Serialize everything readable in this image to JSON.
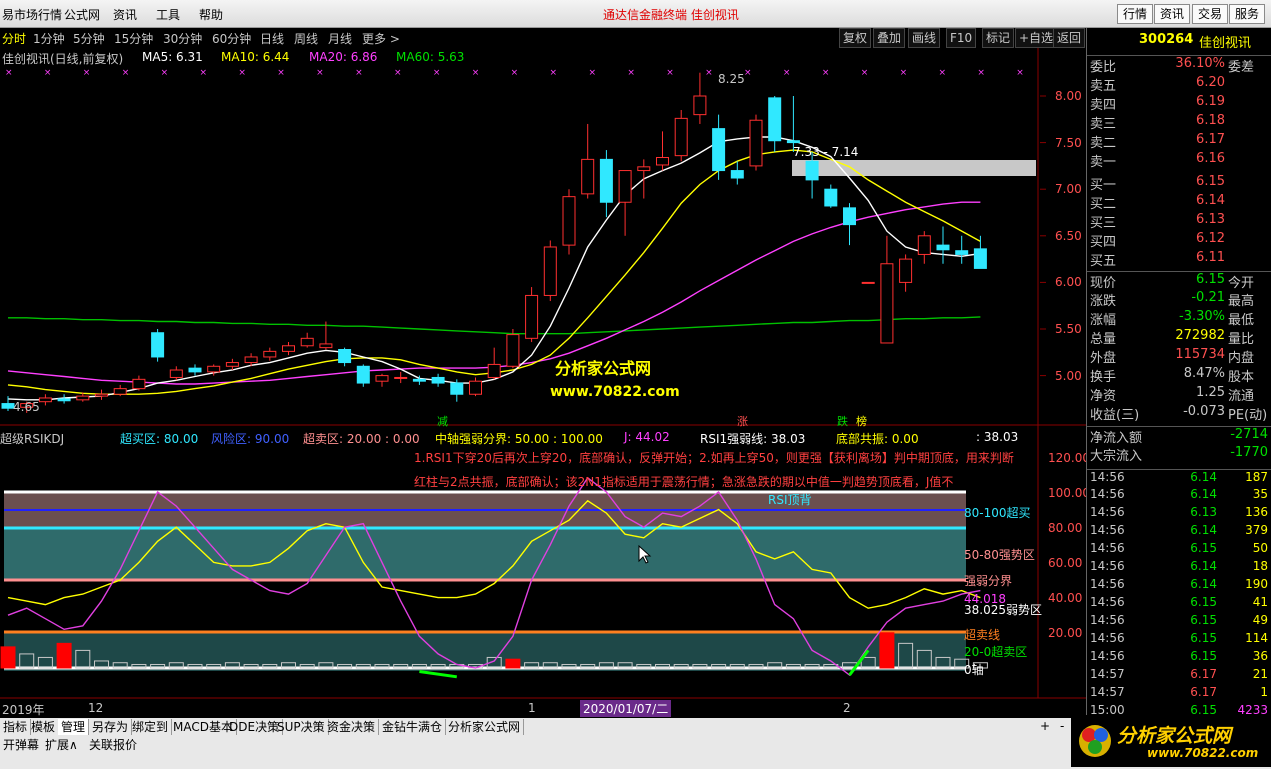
{
  "menu": {
    "items": [
      "易市场行情",
      "公式网",
      "资讯",
      "工具",
      "帮助"
    ],
    "center_title": "通达信金融终端    佳创视讯",
    "right_buttons": [
      "行情",
      "资讯",
      "交易",
      "服务"
    ]
  },
  "periods": [
    "分时",
    "1分钟",
    "5分钟",
    "15分钟",
    "30分钟",
    "60分钟",
    "日线",
    "周线",
    "月线",
    "更多 >"
  ],
  "toolbar_right": [
    "复权",
    "叠加",
    "画线",
    "F10",
    "标记",
    "+自选",
    "返回"
  ],
  "ma_header": {
    "title": "佳创视讯(日线,前复权)",
    "ma5": "MA5: 6.31",
    "ma10": "MA10: 6.44",
    "ma20": "MA20: 6.86",
    "ma60": "MA60: 5.63"
  },
  "price_axis": [
    "8.00",
    "7.50",
    "7.00",
    "6.50",
    "6.00",
    "5.50",
    "5.00"
  ],
  "price_annotations": {
    "high": "8.25",
    "low": "4.65",
    "zone": "7.33 - 7.14"
  },
  "signal_labels": [
    "减",
    "涨",
    "跌",
    "榜"
  ],
  "watermark": {
    "title": "分析家公式网",
    "url": "www.70822.com"
  },
  "indicator_header": {
    "name": "超级RSIKDJ",
    "overbuy": "超买区: 80.00",
    "risk": "风险区: 90.00",
    "oversell": "超卖区: 20.00 : 0.00",
    "mid": "中轴强弱分界: 50.00 : 100.00",
    "j": "J: 44.02",
    "rsi1": "RSI1强弱线: 38.03",
    "bottom_res": "底部共振: 0.00",
    "last": ": 38.03"
  },
  "indicator_notes": {
    "line1": "1.RSI1下穿20后再次上穿20，底部确认，反弹开始；2.如再上穿50，则更强【获利离场】判中期顶底，用来判断",
    "line2": "红柱与2点共振，底部确认；该2N1指标适用于震荡行情；急涨急跌的期以中值一判趋势顶底看，J值不"
  },
  "indicator_axis": [
    "120.00",
    "100.00",
    "80.00",
    "60.00",
    "40.00",
    "20.00"
  ],
  "indicator_zone_labels": {
    "z1": "80-100超买",
    "z2": "50-80强势区",
    "z3": "强弱分界",
    "z4": "44.018",
    "z5": "38.025弱势区",
    "z6": "超卖线",
    "z7": "20-0超卖区",
    "z8": "0轴",
    "rsi_top": "RSI顶背"
  },
  "date_axis": {
    "year": "2019年",
    "m12": "12",
    "m1": "1",
    "current": "2020/01/07/二",
    "m2": "2"
  },
  "quote": {
    "code": "300264",
    "name": "佳创视讯",
    "weibi_label": "委比",
    "weibi": "36.10%",
    "weicha_label": "委差",
    "asks": [
      {
        "label": "卖五",
        "price": "6.20"
      },
      {
        "label": "卖四",
        "price": "6.19"
      },
      {
        "label": "卖三",
        "price": "6.18"
      },
      {
        "label": "卖二",
        "price": "6.17"
      },
      {
        "label": "卖一",
        "price": "6.16"
      }
    ],
    "bids": [
      {
        "label": "买一",
        "price": "6.15"
      },
      {
        "label": "买二",
        "price": "6.14"
      },
      {
        "label": "买三",
        "price": "6.13"
      },
      {
        "label": "买四",
        "price": "6.12"
      },
      {
        "label": "买五",
        "price": "6.11"
      }
    ],
    "stats": [
      {
        "label": "现价",
        "value": "6.15",
        "right": "今开",
        "color": "#00e000"
      },
      {
        "label": "涨跌",
        "value": "-0.21",
        "right": "最高",
        "color": "#00e000"
      },
      {
        "label": "涨幅",
        "value": "-3.30%",
        "right": "最低",
        "color": "#00e000"
      },
      {
        "label": "总量",
        "value": "272982",
        "right": "量比",
        "color": "#ffff00"
      },
      {
        "label": "外盘",
        "value": "115734",
        "right": "内盘",
        "color": "#ff5050"
      },
      {
        "label": "换手",
        "value": "8.47%",
        "right": "股本",
        "color": "#c8c8c8"
      },
      {
        "label": "净资",
        "value": "1.25",
        "right": "流通",
        "color": "#c8c8c8"
      },
      {
        "label": "收益(三)",
        "value": "-0.073",
        "right": "PE(动)",
        "color": "#c8c8c8"
      }
    ],
    "flows": [
      {
        "label": "净流入额",
        "value": "-2714"
      },
      {
        "label": "大宗流入",
        "value": "-1770"
      }
    ],
    "ticks": [
      {
        "time": "14:56",
        "price": "6.14",
        "vol": "187"
      },
      {
        "time": "14:56",
        "price": "6.14",
        "vol": "35"
      },
      {
        "time": "14:56",
        "price": "6.13",
        "vol": "136"
      },
      {
        "time": "14:56",
        "price": "6.14",
        "vol": "379"
      },
      {
        "time": "14:56",
        "price": "6.15",
        "vol": "50"
      },
      {
        "time": "14:56",
        "price": "6.14",
        "vol": "18"
      },
      {
        "time": "14:56",
        "price": "6.14",
        "vol": "190"
      },
      {
        "time": "14:56",
        "price": "6.15",
        "vol": "41"
      },
      {
        "time": "14:56",
        "price": "6.15",
        "vol": "49"
      },
      {
        "time": "14:56",
        "price": "6.15",
        "vol": "114"
      },
      {
        "time": "14:56",
        "price": "6.15",
        "vol": "36"
      },
      {
        "time": "14:57",
        "price": "6.17",
        "vol": "21"
      },
      {
        "time": "14:57",
        "price": "6.17",
        "vol": "1"
      },
      {
        "time": "15:00",
        "price": "6.15",
        "vol": "4233"
      }
    ]
  },
  "bottom_tabs": [
    "指标",
    "模板",
    "管理",
    "另存为",
    "绑定到",
    "MACD基本",
    "DDE决策",
    "SUP决策",
    "资金决策",
    "金钻牛满仓",
    "分析家公式网"
  ],
  "bottom_tabs2": [
    "开弹幕",
    "扩展∧",
    "关联报价"
  ],
  "logo": {
    "name": "分析家公式网",
    "url": "www.70822.com"
  },
  "candles": [
    [
      4.7,
      4.78,
      4.62,
      4.65
    ],
    [
      4.66,
      4.72,
      4.6,
      4.7
    ],
    [
      4.72,
      4.8,
      4.68,
      4.76
    ],
    [
      4.75,
      4.8,
      4.7,
      4.73
    ],
    [
      4.74,
      4.82,
      4.72,
      4.78
    ],
    [
      4.78,
      4.85,
      4.74,
      4.8
    ],
    [
      4.8,
      4.9,
      4.78,
      4.86
    ],
    [
      4.86,
      5.0,
      4.84,
      4.96
    ],
    [
      5.46,
      5.5,
      5.15,
      5.2
    ],
    [
      4.98,
      5.1,
      4.95,
      5.06
    ],
    [
      5.08,
      5.12,
      5.0,
      5.04
    ],
    [
      5.04,
      5.12,
      5.0,
      5.1
    ],
    [
      5.1,
      5.18,
      5.06,
      5.14
    ],
    [
      5.14,
      5.24,
      5.1,
      5.2
    ],
    [
      5.2,
      5.3,
      5.16,
      5.26
    ],
    [
      5.26,
      5.36,
      5.22,
      5.32
    ],
    [
      5.32,
      5.46,
      5.3,
      5.4
    ],
    [
      5.3,
      5.58,
      5.28,
      5.34
    ],
    [
      5.28,
      5.3,
      5.1,
      5.14
    ],
    [
      5.1,
      5.12,
      4.88,
      4.92
    ],
    [
      4.94,
      5.02,
      4.88,
      5.0
    ],
    [
      4.98,
      5.04,
      4.92,
      4.98
    ],
    [
      4.96,
      5.0,
      4.9,
      4.94
    ],
    [
      4.98,
      5.02,
      4.88,
      4.92
    ],
    [
      4.92,
      4.96,
      4.72,
      4.8
    ],
    [
      4.8,
      4.98,
      4.78,
      4.94
    ],
    [
      4.98,
      5.3,
      4.96,
      5.12
    ],
    [
      5.1,
      5.5,
      5.08,
      5.44
    ],
    [
      5.4,
      5.95,
      5.36,
      5.86
    ],
    [
      5.86,
      6.45,
      5.8,
      6.38
    ],
    [
      6.4,
      7.0,
      6.3,
      6.92
    ],
    [
      6.95,
      7.7,
      6.9,
      7.32
    ],
    [
      7.32,
      7.42,
      6.7,
      6.86
    ],
    [
      6.86,
      7.2,
      6.5,
      7.2
    ],
    [
      7.2,
      7.32,
      6.9,
      7.24
    ],
    [
      7.26,
      7.62,
      7.2,
      7.34
    ],
    [
      7.36,
      7.85,
      7.3,
      7.76
    ],
    [
      7.8,
      8.25,
      7.7,
      8.0
    ],
    [
      7.65,
      7.8,
      7.1,
      7.2
    ],
    [
      7.2,
      7.3,
      7.05,
      7.12
    ],
    [
      7.25,
      7.8,
      7.2,
      7.74
    ],
    [
      7.98,
      8.0,
      7.4,
      7.52
    ],
    [
      7.52,
      8.0,
      7.4,
      7.5
    ],
    [
      7.3,
      7.4,
      6.9,
      7.1
    ],
    [
      7.0,
      7.05,
      6.8,
      6.82
    ],
    [
      6.8,
      6.85,
      6.4,
      6.62
    ],
    [
      6.0,
      6.0,
      6.0,
      6.0
    ],
    [
      5.35,
      6.5,
      5.35,
      6.2
    ],
    [
      6.0,
      6.3,
      5.9,
      6.25
    ],
    [
      6.3,
      6.55,
      6.2,
      6.5
    ],
    [
      6.4,
      6.6,
      6.2,
      6.35
    ],
    [
      6.34,
      6.5,
      6.2,
      6.3
    ],
    [
      6.36,
      6.5,
      6.15,
      6.15
    ]
  ],
  "ma5": [
    4.75,
    4.74,
    4.74,
    4.76,
    4.77,
    4.78,
    4.82,
    4.86,
    4.92,
    4.95,
    4.99,
    5.03,
    5.06,
    5.11,
    5.14,
    5.19,
    5.24,
    5.27,
    5.25,
    5.2,
    5.15,
    5.07,
    4.97,
    4.95,
    4.92,
    4.92,
    4.96,
    5.04,
    5.22,
    5.53,
    5.94,
    6.38,
    6.67,
    6.94,
    7.11,
    7.2,
    7.28,
    7.39,
    7.51,
    7.54,
    7.56,
    7.56,
    7.52,
    7.45,
    7.35,
    7.12,
    6.88,
    6.55,
    6.38,
    6.32,
    6.3,
    6.28,
    6.31
  ],
  "ma10": [
    4.9,
    4.88,
    4.85,
    4.83,
    4.81,
    4.8,
    4.8,
    4.8,
    4.81,
    4.83,
    4.86,
    4.89,
    4.93,
    4.97,
    5.02,
    5.07,
    5.11,
    5.15,
    5.18,
    5.19,
    5.19,
    5.17,
    5.12,
    5.08,
    5.04,
    5.01,
    5.03,
    5.06,
    5.12,
    5.22,
    5.4,
    5.62,
    5.85,
    6.08,
    6.32,
    6.58,
    6.85,
    7.05,
    7.2,
    7.3,
    7.37,
    7.4,
    7.42,
    7.4,
    7.32,
    7.24,
    7.1,
    6.98,
    6.86,
    6.76,
    6.66,
    6.55,
    6.44
  ],
  "ma20": [
    5.05,
    5.03,
    5.01,
    4.99,
    4.97,
    4.95,
    4.94,
    4.93,
    4.92,
    4.91,
    4.91,
    4.92,
    4.93,
    4.94,
    4.95,
    4.97,
    4.99,
    5.01,
    5.03,
    5.05,
    5.06,
    5.07,
    5.08,
    5.08,
    5.08,
    5.08,
    5.09,
    5.11,
    5.14,
    5.18,
    5.24,
    5.32,
    5.4,
    5.49,
    5.58,
    5.68,
    5.79,
    5.91,
    6.02,
    6.13,
    6.24,
    6.34,
    6.44,
    6.52,
    6.59,
    6.65,
    6.7,
    6.74,
    6.78,
    6.81,
    6.84,
    6.86,
    6.86
  ],
  "ma60": [
    5.62,
    5.62,
    5.61,
    5.61,
    5.6,
    5.6,
    5.59,
    5.59,
    5.58,
    5.58,
    5.57,
    5.57,
    5.56,
    5.56,
    5.55,
    5.55,
    5.54,
    5.54,
    5.53,
    5.53,
    5.52,
    5.51,
    5.5,
    5.49,
    5.48,
    5.47,
    5.46,
    5.45,
    5.45,
    5.45,
    5.45,
    5.46,
    5.47,
    5.48,
    5.49,
    5.5,
    5.51,
    5.52,
    5.53,
    5.54,
    5.55,
    5.56,
    5.57,
    5.57,
    5.58,
    5.59,
    5.59,
    5.6,
    5.61,
    5.61,
    5.62,
    5.62,
    5.63
  ],
  "rsi_yellow": [
    40,
    38,
    36,
    40,
    42,
    46,
    50,
    60,
    72,
    80,
    70,
    60,
    58,
    58,
    60,
    68,
    78,
    82,
    80,
    60,
    46,
    44,
    42,
    40,
    40,
    42,
    48,
    58,
    72,
    78,
    84,
    95,
    88,
    76,
    74,
    82,
    80,
    85,
    90,
    82,
    66,
    62,
    66,
    56,
    54,
    40,
    34,
    36,
    40,
    45,
    42,
    44,
    40
  ],
  "j_magenta": [
    30,
    34,
    28,
    22,
    24,
    38,
    56,
    78,
    100,
    92,
    80,
    68,
    56,
    50,
    44,
    42,
    48,
    64,
    80,
    82,
    60,
    38,
    18,
    8,
    2,
    0,
    4,
    18,
    50,
    70,
    92,
    108,
    100,
    86,
    80,
    88,
    86,
    92,
    100,
    84,
    62,
    36,
    28,
    10,
    4,
    -4,
    12,
    26,
    34,
    36,
    38,
    42,
    44
  ],
  "volume_bars": [
    12,
    8,
    6,
    14,
    10,
    4,
    3,
    2,
    2,
    3,
    2,
    2,
    3,
    2,
    2,
    3,
    2,
    3,
    2,
    2,
    2,
    2,
    2,
    2,
    2,
    2,
    6,
    5,
    3,
    3,
    2,
    2,
    3,
    3,
    2,
    2,
    2,
    2,
    2,
    2,
    2,
    3,
    2,
    2,
    2,
    3,
    6,
    20,
    14,
    10,
    6,
    5,
    3
  ]
}
